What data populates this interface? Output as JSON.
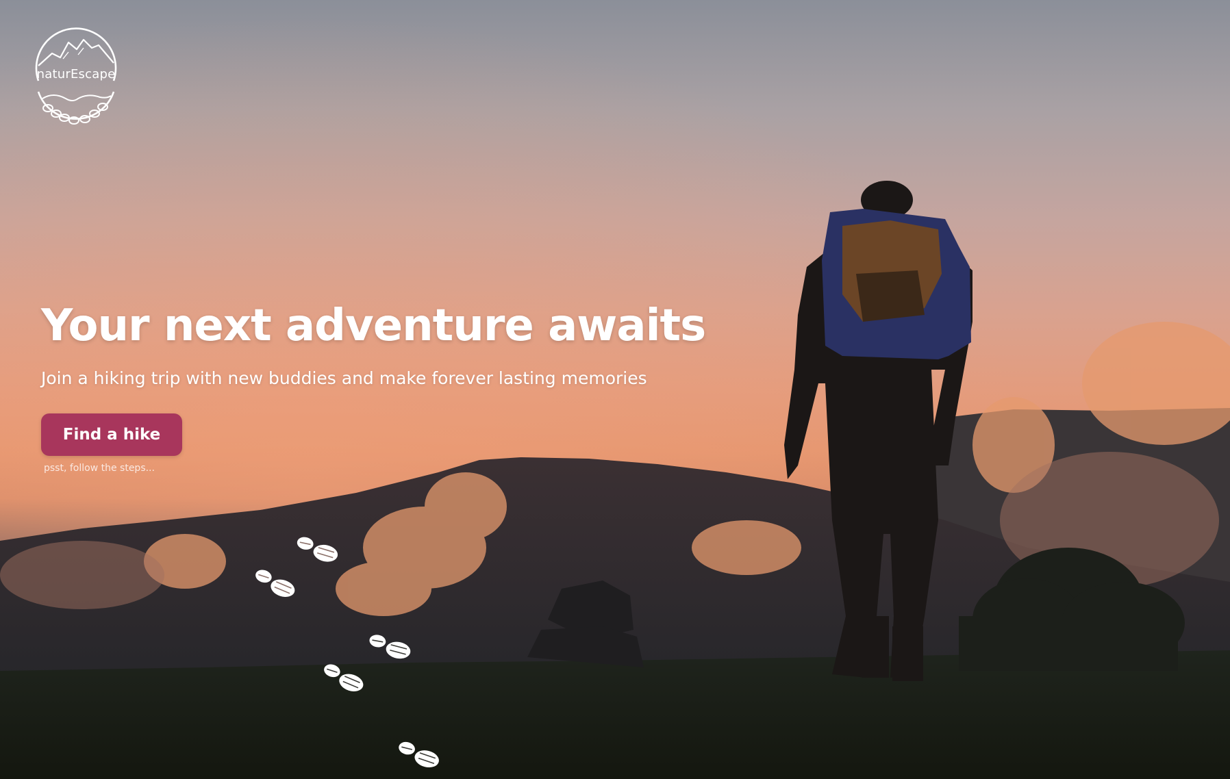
{
  "brand": {
    "name": "naturEscape",
    "logo_icon": "mountain-handshake-logo"
  },
  "hero": {
    "headline": "Your next adventure awaits",
    "subheadline": "Join a hiking trip with new buddies and make forever lasting memories",
    "cta_label": "Find a hike",
    "hint": "psst, follow the steps..."
  },
  "colors": {
    "cta_background": "#a8365c",
    "text": "#ffffff"
  },
  "decor": {
    "footprint_icon": "boot-footprint-icon",
    "footprint_count": 5,
    "background_icon": "hiker-sunset-photo"
  }
}
